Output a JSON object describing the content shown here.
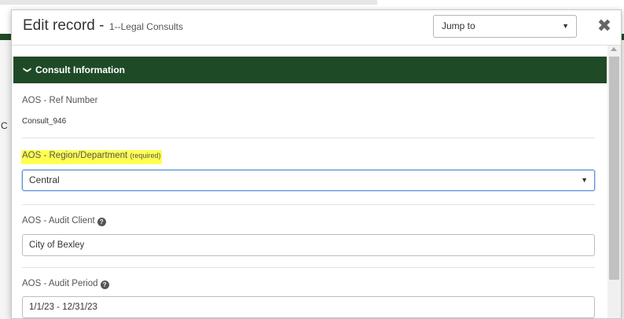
{
  "background": {
    "side_letter": "C"
  },
  "modal": {
    "title": "Edit record -",
    "subtitle": "1--Legal Consults",
    "jump_to": "Jump to",
    "close_glyph": "✖"
  },
  "section": {
    "title": "Consult Information",
    "chevron_glyph": "❯"
  },
  "fields": {
    "ref_number": {
      "label": "AOS - Ref Number",
      "value": "Consult_946"
    },
    "region": {
      "label": "AOS - Region/Department",
      "required_text": "(required)",
      "value": "Central"
    },
    "audit_client": {
      "label": "AOS - Audit Client",
      "value": "City of Bexley"
    },
    "audit_period": {
      "label": "AOS - Audit Period",
      "value": "1/1/23 - 12/31/23"
    }
  },
  "colors": {
    "section_header": "#1f4a26",
    "highlight": "#ffff52",
    "focus_border": "#5b90d8"
  }
}
